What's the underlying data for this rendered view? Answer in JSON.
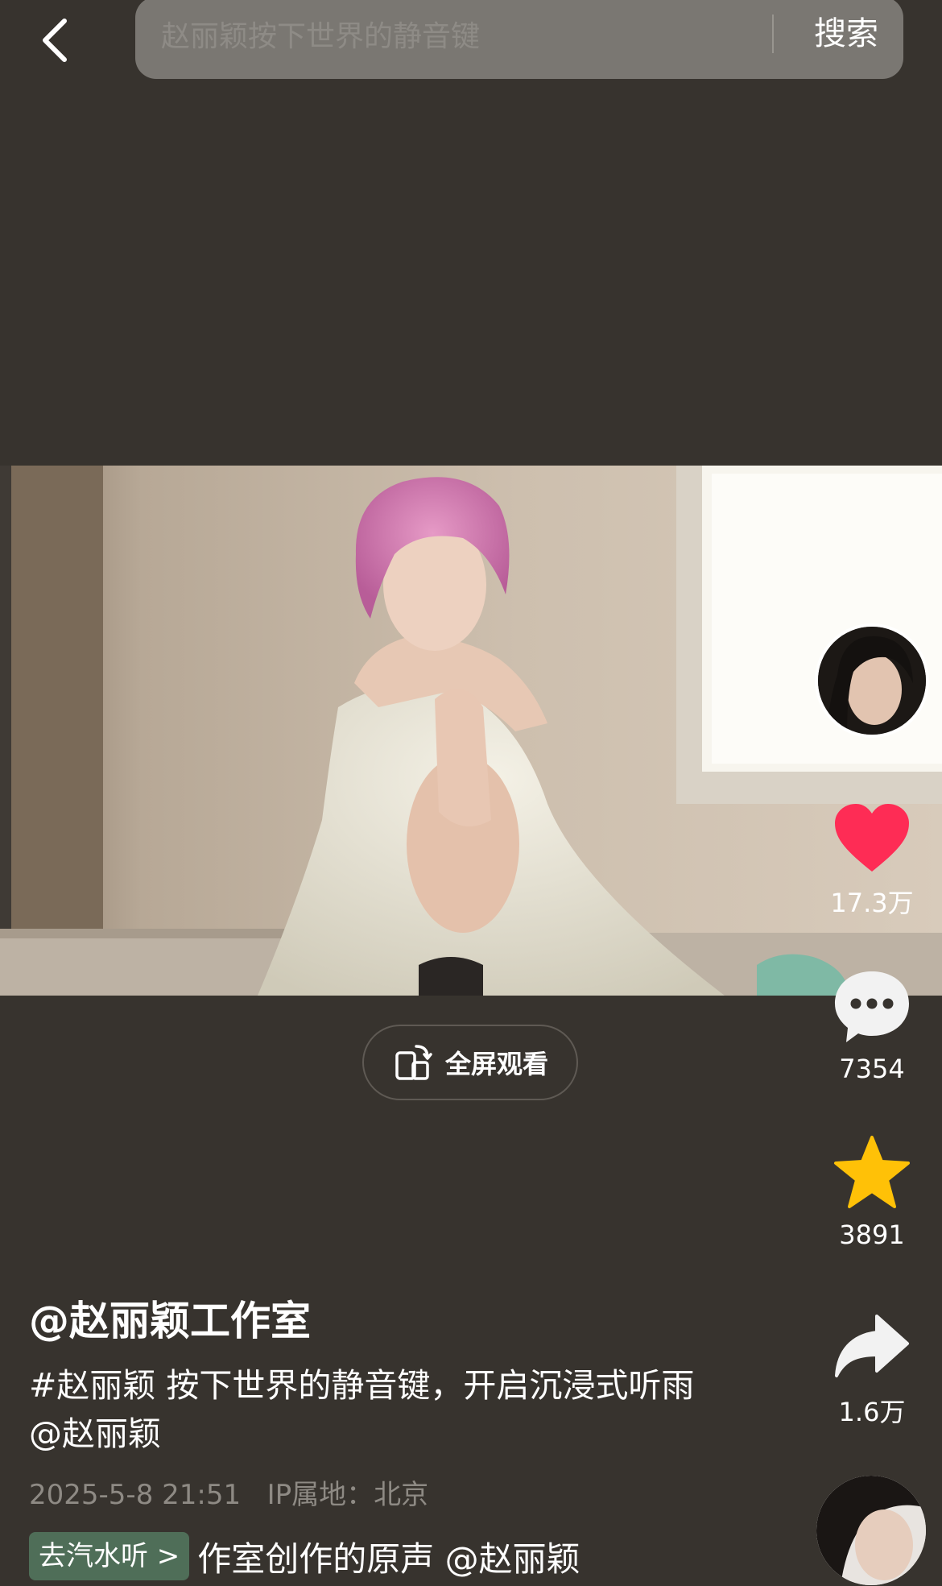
{
  "header": {
    "search_placeholder": "赵丽颖按下世界的静音键",
    "search_button": "搜索"
  },
  "video": {
    "fullscreen_label": "全屏观看"
  },
  "actions": {
    "like_count": "17.3万",
    "comment_count": "7354",
    "favorite_count": "3891",
    "share_count": "1.6万"
  },
  "post": {
    "author": "@赵丽颖工作室",
    "description": "#赵丽颖 按下世界的静音键，开启沉浸式听雨@赵丽颖",
    "date": "2025-5-8 21:51",
    "ip_location": "IP属地：北京"
  },
  "music": {
    "tag": "去汽水听 >",
    "track": "作室创作的原声    @赵丽颖"
  },
  "colors": {
    "background": "#37332e",
    "like": "#fe2c55",
    "favorite": "#ffc107",
    "music_tag": "#4f6e58"
  },
  "icons": [
    "back-icon",
    "like-heart-icon",
    "comment-icon",
    "favorite-star-icon",
    "share-icon",
    "fullscreen-rotate-icon"
  ]
}
